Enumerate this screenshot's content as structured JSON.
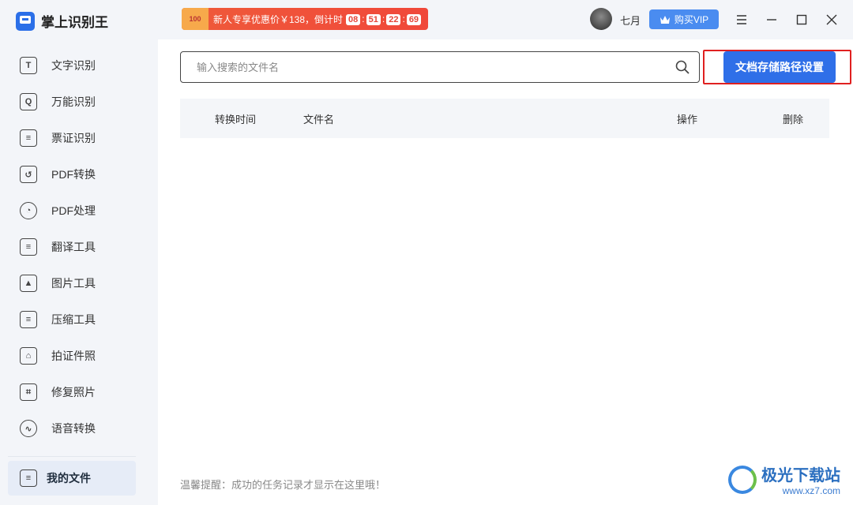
{
  "app": {
    "title": "掌上识别王"
  },
  "sidebar": {
    "items": [
      {
        "label": "文字识别",
        "icon": "text-recognition-icon",
        "glyph": "T"
      },
      {
        "label": "万能识别",
        "icon": "universal-recognition-icon",
        "glyph": "Q"
      },
      {
        "label": "票证识别",
        "icon": "ticket-recognition-icon",
        "glyph": "≡"
      },
      {
        "label": "PDF转换",
        "icon": "pdf-convert-icon",
        "glyph": "↺"
      },
      {
        "label": "PDF处理",
        "icon": "pdf-process-icon",
        "glyph": "◔"
      },
      {
        "label": "翻译工具",
        "icon": "translate-icon",
        "glyph": "≡"
      },
      {
        "label": "图片工具",
        "icon": "image-tool-icon",
        "glyph": "▲"
      },
      {
        "label": "压缩工具",
        "icon": "compress-icon",
        "glyph": "≡"
      },
      {
        "label": "拍证件照",
        "icon": "id-photo-icon",
        "glyph": "⌂"
      },
      {
        "label": "修复照片",
        "icon": "repair-photo-icon",
        "glyph": "⌗"
      },
      {
        "label": "语音转换",
        "icon": "voice-convert-icon",
        "glyph": "∿"
      }
    ],
    "active": {
      "label": "我的文件",
      "icon": "my-files-icon",
      "glyph": "≡"
    }
  },
  "topbar": {
    "promo_badge": "100",
    "promo_text": "新人专享优惠价￥138，倒计时",
    "countdown": [
      "08",
      "51",
      "22",
      "69"
    ],
    "username": "七月",
    "vip_label": "购买VIP"
  },
  "search": {
    "placeholder": "输入搜索的文件名"
  },
  "path_button": "文档存储路径设置",
  "table": {
    "headers": {
      "time": "转换时间",
      "name": "文件名",
      "action": "操作",
      "delete": "删除"
    }
  },
  "tip": "温馨提醒：成功的任务记录才显示在这里哦！",
  "watermark": {
    "main": "极光下载站",
    "sub": "www.xz7.com"
  },
  "colors": {
    "accent": "#2f6fe8",
    "highlight": "#e02020",
    "promo": "#ef5a3a"
  }
}
